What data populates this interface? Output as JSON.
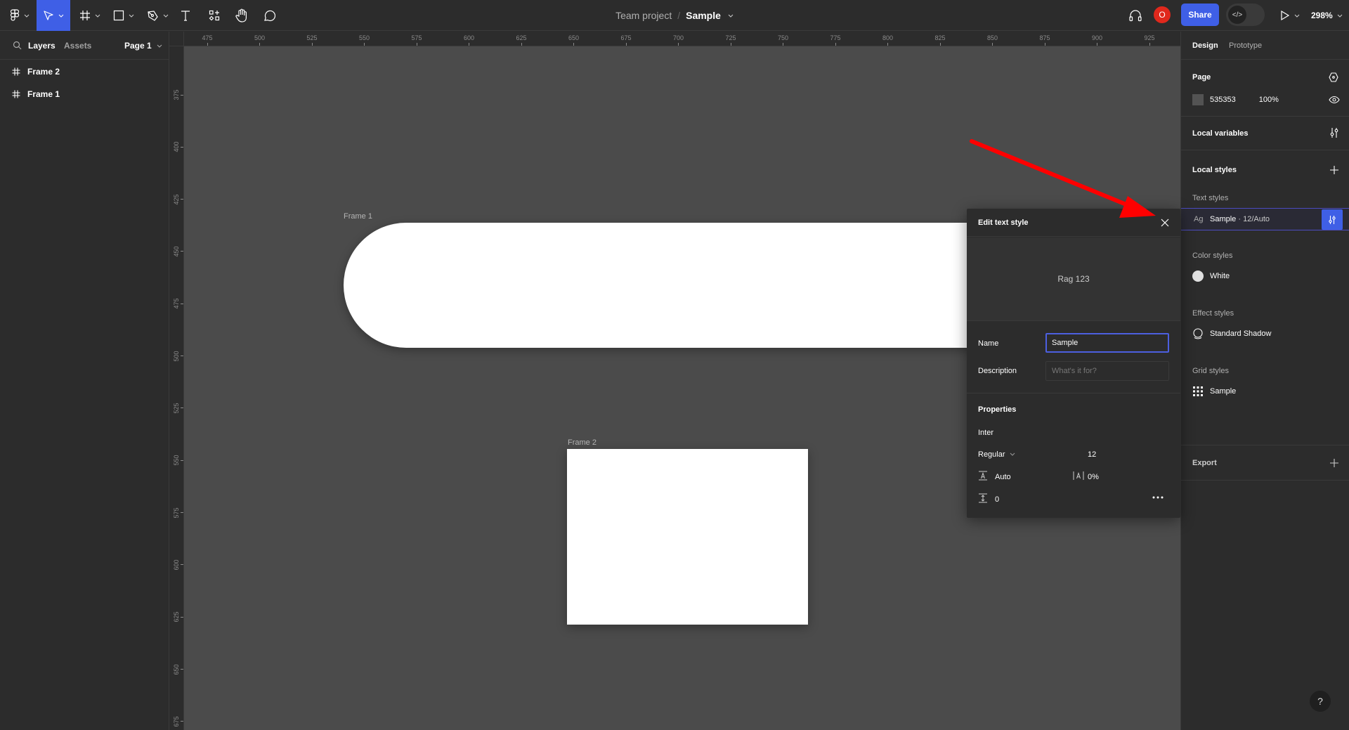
{
  "toolbar": {
    "main_menu_icon": "figma-logo-icon",
    "tools": [
      {
        "name": "move-tool",
        "icon": "cursor-arrow-icon",
        "active": true
      },
      {
        "name": "frame-tool",
        "icon": "hash-frame-icon"
      },
      {
        "name": "shape-tool",
        "icon": "rectangle-icon"
      },
      {
        "name": "pen-tool",
        "icon": "pen-icon"
      },
      {
        "name": "text-tool",
        "icon": "text-T-icon"
      },
      {
        "name": "resources-tool",
        "icon": "components-icon"
      },
      {
        "name": "hand-tool",
        "icon": "hand-icon"
      },
      {
        "name": "comment-tool",
        "icon": "speech-bubble-icon"
      }
    ]
  },
  "header": {
    "team": "Team project",
    "separator": "/",
    "file_name": "Sample",
    "avatar_initial": "O",
    "share_label": "Share",
    "dev_mode_glyph": "</>",
    "zoom": "298%"
  },
  "left_panel": {
    "tabs": [
      "Layers",
      "Assets"
    ],
    "active_tab": "Layers",
    "page_selector": "Page 1",
    "layers": [
      "Frame 2",
      "Frame 1"
    ]
  },
  "rulers": {
    "horizontal": [
      475,
      500,
      525,
      550,
      575,
      600,
      625,
      650,
      675,
      700,
      725,
      750,
      775,
      800,
      825,
      850,
      875,
      900,
      925
    ],
    "vertical": [
      375,
      400,
      425,
      450,
      475,
      500,
      525,
      550,
      575,
      600,
      625,
      650,
      675
    ]
  },
  "canvas": {
    "background": "#4b4b4b",
    "frames": [
      {
        "label": "Frame 1"
      },
      {
        "label": "Frame 2"
      }
    ]
  },
  "right_panel": {
    "tabs": [
      "Design",
      "Prototype"
    ],
    "active_tab": "Design",
    "page": {
      "title": "Page",
      "color_hex": "535353",
      "color_swatch": "#535353",
      "opacity": "100%"
    },
    "local_variables": "Local variables",
    "local_styles": "Local styles",
    "text_styles": {
      "heading": "Text styles",
      "items": [
        {
          "preview": "Ag",
          "name": "Sample",
          "meta": "· 12/Auto"
        }
      ]
    },
    "color_styles": {
      "heading": "Color styles",
      "items": [
        {
          "name": "White",
          "color": "#e0e0e0"
        }
      ]
    },
    "effect_styles": {
      "heading": "Effect styles",
      "items": [
        {
          "name": "Standard Shadow"
        }
      ]
    },
    "grid_styles": {
      "heading": "Grid styles",
      "items": [
        {
          "name": "Sample"
        }
      ]
    },
    "export": "Export"
  },
  "modal": {
    "title": "Edit text style",
    "preview_text": "Rag 123",
    "name_label": "Name",
    "name_value": "Sample",
    "description_label": "Description",
    "description_placeholder": "What's it for?",
    "properties_label": "Properties",
    "font_family": "Inter",
    "font_weight": "Regular",
    "font_size": "12",
    "line_height": "Auto",
    "letter_spacing": "0%",
    "paragraph_spacing": "0"
  },
  "annotation": {
    "arrow_color": "#ff0000"
  },
  "help_label": "?"
}
